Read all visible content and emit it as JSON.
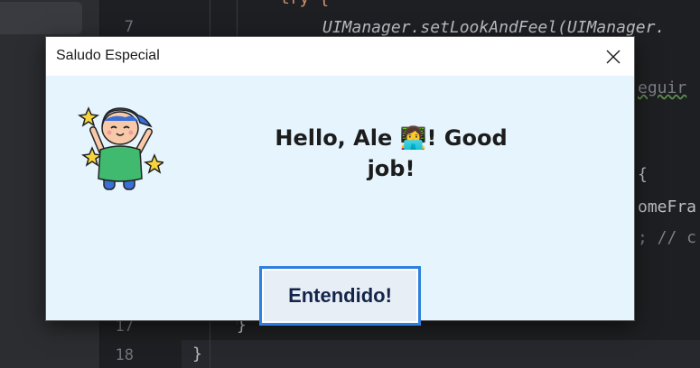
{
  "dialog": {
    "title": "Saludo Especial",
    "message": "Hello, Ale 👩‍💻! Good job!",
    "ok_label": "Entendido!",
    "close_icon": "close-icon",
    "sticker_icon": "happy-kid-sticker"
  },
  "editor": {
    "lines": [
      {
        "number": "7",
        "text": "UIManager.setLookAndFeel(UIManager."
      },
      {
        "number": "17",
        "text": "}"
      },
      {
        "number": "18",
        "text": "}"
      }
    ],
    "fragments": {
      "try_kw": "try {",
      "seguir": "eguir",
      "brace_open": "{",
      "home_fra": "omeFra",
      "comment_tail": "; // c"
    }
  },
  "colors": {
    "dialog_bg": "#e6f4fd",
    "button_border": "#2f7fe0",
    "ide_bg": "#1e1f22"
  }
}
